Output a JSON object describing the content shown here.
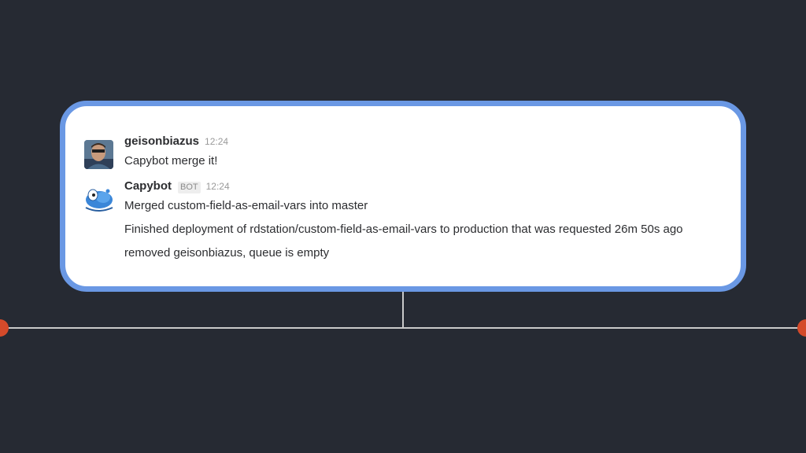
{
  "messages": [
    {
      "author": "geisonbiazus",
      "time": "12:24",
      "lines": [
        "Capybot merge it!"
      ]
    },
    {
      "author": "Capybot",
      "badge": "BOT",
      "time": "12:24",
      "lines": [
        "Merged custom-field-as-email-vars into master",
        "Finished deployment of rdstation/custom-field-as-email-vars to production that was requested 26m 50s ago",
        "removed geisonbiazus, queue is empty"
      ]
    }
  ],
  "colors": {
    "background": "#262a33",
    "card_border": "#6a98e4",
    "timeline_dot": "#d44a2a",
    "timeline_line": "#c9c9c9"
  }
}
